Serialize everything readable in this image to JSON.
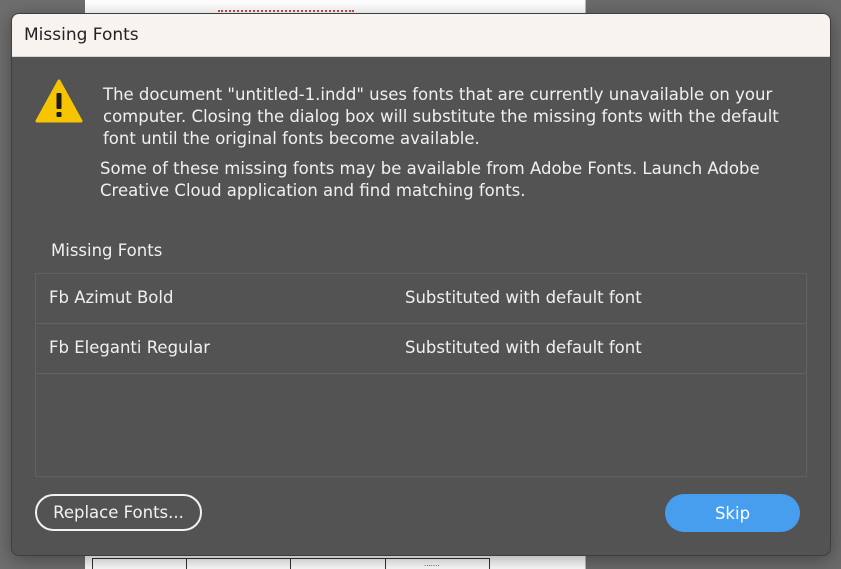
{
  "dialog": {
    "title": "Missing Fonts",
    "message_primary": "The document \"untitled-1.indd\" uses fonts that are currently unavailable on your computer. Closing the dialog box will substitute the missing fonts with the default font until the original fonts become available.",
    "message_secondary": "Some of these missing fonts may be available from Adobe Fonts. Launch Adobe Creative Cloud application and find matching fonts.",
    "section_label": "Missing Fonts",
    "icon": "warning-triangle-icon",
    "fonts": [
      {
        "name": "Fb Azimut Bold",
        "status": "Substituted with default font"
      },
      {
        "name": "Fb Eleganti Regular",
        "status": "Substituted with default font"
      }
    ],
    "buttons": {
      "replace_label": "Replace Fonts...",
      "skip_label": "Skip"
    }
  },
  "colors": {
    "dialog_bg": "#535353",
    "titlebar_bg": "#f8f3ef",
    "accent": "#479eee",
    "warning": "#f6c400"
  }
}
